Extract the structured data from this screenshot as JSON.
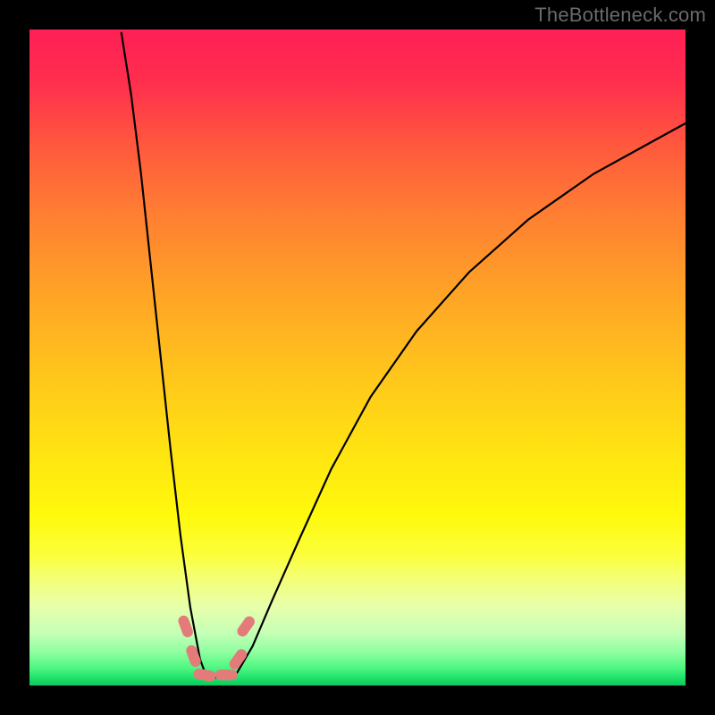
{
  "watermark": "TheBottleneck.com",
  "colors": {
    "frame_bg": "#000000",
    "watermark_text": "#6a6a6a",
    "curve_stroke": "#000000",
    "marker_fill": "#e47b7b",
    "gradient_stops": [
      "#ff1f55",
      "#ff5a3d",
      "#ffa326",
      "#ffe312",
      "#fbff3a",
      "#c5ffb6",
      "#1adf67",
      "#0fc85d"
    ]
  },
  "chart_data": {
    "type": "line",
    "title": "",
    "xlabel": "",
    "ylabel": "",
    "xlim": [
      0,
      100
    ],
    "ylim": [
      0,
      100
    ],
    "grid": false,
    "legend": null,
    "note": "Axes unlabeled in source; values are relative percentages estimated from pixel positions. y=100 at top, y=0 at bottom; x=0 left, x=100 right. Two curves share a minimum near x≈27.",
    "series": [
      {
        "name": "left-curve",
        "x": [
          14.0,
          15.5,
          17.0,
          18.5,
          20.0,
          21.5,
          23.0,
          24.5,
          26.0,
          27.0
        ],
        "y": [
          99.5,
          90.0,
          78.0,
          64.0,
          50.0,
          36.0,
          23.0,
          12.0,
          4.0,
          1.3
        ]
      },
      {
        "name": "flat-minimum",
        "x": [
          26.0,
          27.0,
          28.5,
          30.0,
          31.5
        ],
        "y": [
          1.8,
          1.3,
          1.2,
          1.3,
          1.7
        ]
      },
      {
        "name": "right-curve",
        "x": [
          31.5,
          34.0,
          37.0,
          41.0,
          46.0,
          52.0,
          59.0,
          67.0,
          76.0,
          86.0,
          96.0,
          100.0
        ],
        "y": [
          1.7,
          6.0,
          13.0,
          22.0,
          33.0,
          44.0,
          54.0,
          63.0,
          71.0,
          78.0,
          83.5,
          85.7
        ]
      }
    ],
    "markers": [
      {
        "x": 23.8,
        "y": 9.0,
        "shape": "capsule",
        "angle": 70
      },
      {
        "x": 25.0,
        "y": 4.5,
        "shape": "capsule",
        "angle": 70
      },
      {
        "x": 26.7,
        "y": 1.6,
        "shape": "capsule",
        "angle": 10
      },
      {
        "x": 30.0,
        "y": 1.6,
        "shape": "capsule",
        "angle": 0
      },
      {
        "x": 31.8,
        "y": 4.0,
        "shape": "capsule",
        "angle": -55
      },
      {
        "x": 33.0,
        "y": 9.0,
        "shape": "capsule",
        "angle": -55
      }
    ],
    "marker_size_px": {
      "length": 24,
      "thickness": 11
    }
  }
}
